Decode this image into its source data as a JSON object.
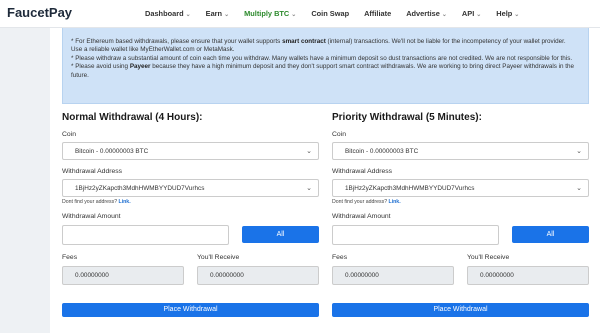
{
  "brand": "FaucetPay",
  "nav": [
    {
      "label": "Dashboard",
      "dropdown": true
    },
    {
      "label": "Earn",
      "dropdown": true
    },
    {
      "label": "Multiply BTC",
      "dropdown": true,
      "active": true
    },
    {
      "label": "Coin Swap",
      "dropdown": false
    },
    {
      "label": "Affiliate",
      "dropdown": false
    },
    {
      "label": "Advertise",
      "dropdown": true
    },
    {
      "label": "API",
      "dropdown": true
    },
    {
      "label": "Help",
      "dropdown": true
    }
  ],
  "notice": {
    "line1_pre": "* For Ethereum based withdrawals, please ensure that your wallet supports ",
    "line1_bold": "smart contract",
    "line1_post": " (internal) transactions. We'll not be liable for the incompetency of your wallet provider.",
    "line2": "Use a reliable wallet like MyEtherWallet.com or MetaMask.",
    "line3": "* Please withdraw a substantial amount of coin each time you withdraw. Many wallets have a minimum deposit so dust transactions are not credited. We are not responsible for this.",
    "line4_pre": "* Please avoid using ",
    "line4_bold": "Payeer",
    "line4_post": " because they have a high minimum deposit and they don't support smart contract withdrawals. We are working to bring direct Payeer withdrawals in the future."
  },
  "normal": {
    "title": "Normal Withdrawal (4 Hours):",
    "coin_label": "Coin",
    "coin_value": "Bitcoin - 0.00000003 BTC",
    "address_label": "Withdrawal Address",
    "address_value": "1BjHz2yZKapcth3MdhHWMBYYDUD7Vurhcs",
    "help_text": "Dont find your address?",
    "help_link": "Link.",
    "amount_label": "Withdrawal Amount",
    "all_label": "All",
    "fees_label": "Fees",
    "fees_value": "0.00000000",
    "receive_label": "You'll Receive",
    "receive_value": "0.00000000",
    "place_label": "Place Withdrawal"
  },
  "priority": {
    "title": "Priority Withdrawal (5 Minutes):",
    "coin_label": "Coin",
    "coin_value": "Bitcoin - 0.00000003 BTC",
    "address_label": "Withdrawal Address",
    "address_value": "1BjHz2yZKapcth3MdhHWMBYYDUD7Vurhcs",
    "help_text": "Dont find your address?",
    "help_link": "Link.",
    "amount_label": "Withdrawal Amount",
    "all_label": "All",
    "fees_label": "Fees",
    "fees_value": "0.00000000",
    "receive_label": "You'll Receive",
    "receive_value": "0.00000000",
    "place_label": "Place Withdrawal"
  },
  "colors": {
    "primary": "#1a73e8",
    "notice_bg": "#cfe2f7",
    "active_nav": "#2c8a2c"
  }
}
